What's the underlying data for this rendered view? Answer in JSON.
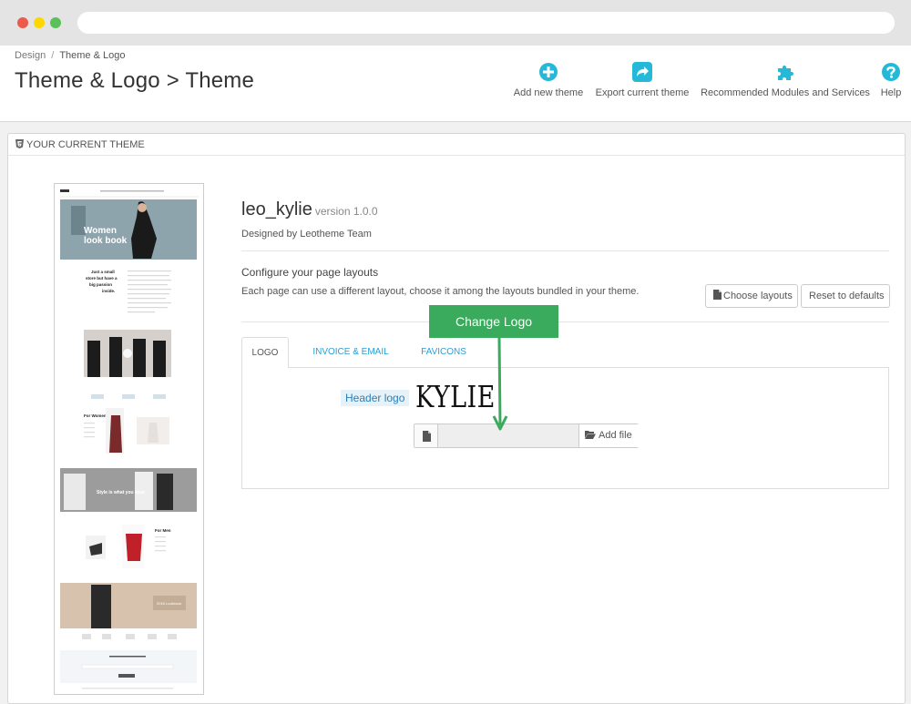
{
  "breadcrumb": {
    "items": [
      "Design",
      "Theme & Logo"
    ],
    "separator": "/"
  },
  "page_title": "Theme & Logo > Theme",
  "toolbar": {
    "add_new_theme": "Add new theme",
    "export_current_theme": "Export current theme",
    "recommended_modules": "Recommended Modules and Services",
    "help": "Help",
    "icon_color": "#25b9d7"
  },
  "panel": {
    "heading": "YOUR CURRENT THEME"
  },
  "theme": {
    "name": "leo_kylie",
    "version": "version 1.0.0",
    "designer": "Designed by Leotheme Team"
  },
  "layouts": {
    "title": "Configure your page layouts",
    "description": "Each page can use a different layout, choose it among the layouts bundled in your theme.",
    "choose_button": "Choose layouts",
    "reset_button": "Reset to defaults"
  },
  "callout": {
    "label": "Change Logo",
    "color": "#3aaa5c"
  },
  "tabs": [
    {
      "label": "LOGO",
      "active": true
    },
    {
      "label": "INVOICE & EMAIL LOGOS",
      "active": false
    },
    {
      "label": "FAVICONS",
      "active": false
    }
  ],
  "logo_form": {
    "header_logo_label": "Header logo",
    "current_logo_text": "KYLIE",
    "add_file_button": "Add file",
    "file_value": ""
  },
  "preview": {
    "hero_text_1": "Women",
    "hero_text_2": "look book",
    "tagline": "Just a small store but have a big passion inside.",
    "for_women": "For Women",
    "style_text": "Style is what you wear",
    "for_men": "For Men",
    "lookbook": "2016 Lookbook"
  }
}
